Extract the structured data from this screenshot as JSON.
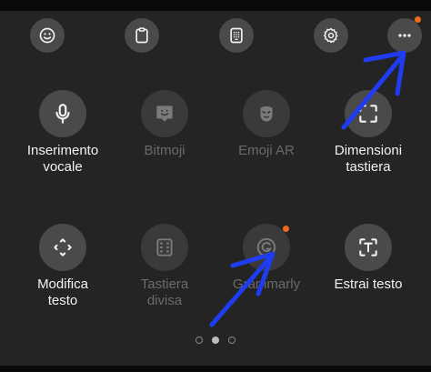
{
  "toolbar": {
    "icons": [
      "emoji-icon",
      "clipboard-icon",
      "keypad-icon",
      "gear-icon",
      "more-icon"
    ]
  },
  "tiles": [
    {
      "label": "Inserimento\nvocale",
      "icon": "microphone-icon",
      "enabled": true
    },
    {
      "label": "Bitmoji",
      "icon": "bitmoji-icon",
      "enabled": false
    },
    {
      "label": "Emoji AR",
      "icon": "ar-emoji-icon",
      "enabled": false
    },
    {
      "label": "Dimensioni\ntastiera",
      "icon": "resize-icon",
      "enabled": true
    },
    {
      "label": "Modifica\ntesto",
      "icon": "text-edit-icon",
      "enabled": true
    },
    {
      "label": "Tastiera\ndivisa",
      "icon": "split-keyboard-icon",
      "enabled": false
    },
    {
      "label": "Grammarly",
      "icon": "grammarly-icon",
      "enabled": false,
      "badge": true
    },
    {
      "label": "Estrai testo",
      "icon": "extract-text-icon",
      "enabled": true
    }
  ],
  "pagination": {
    "count": 3,
    "current": 2
  },
  "colors": {
    "background": "#242424",
    "button": "#4a4a4a",
    "badge": "#f06a1e",
    "annotation_arrow": "#1f3cf0"
  }
}
